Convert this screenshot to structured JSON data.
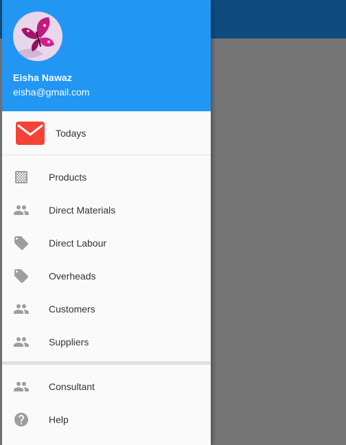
{
  "colors": {
    "app_bar": "#0f4b7f",
    "drawer_header": "#2196f3",
    "mail_badge": "#f44336",
    "icon_gray": "#9e9e9e",
    "scrim": "#747474"
  },
  "header": {
    "avatar_icon": "butterfly-avatar",
    "name": "Eisha Nawaz",
    "email": "eisha@gmail.com"
  },
  "todays": {
    "icon": "mail-icon",
    "label": "Todays"
  },
  "menu": {
    "items": [
      {
        "icon": "grid-icon",
        "label": "Products"
      },
      {
        "icon": "people-icon",
        "label": "Direct Materials"
      },
      {
        "icon": "tag-icon",
        "label": "Direct Labour"
      },
      {
        "icon": "tag-icon",
        "label": "Overheads"
      },
      {
        "icon": "people-icon",
        "label": "Customers"
      },
      {
        "icon": "people-icon",
        "label": "Suppliers"
      }
    ],
    "secondary": [
      {
        "icon": "people-icon",
        "label": "Consultant"
      },
      {
        "icon": "help-icon",
        "label": "Help"
      }
    ]
  }
}
